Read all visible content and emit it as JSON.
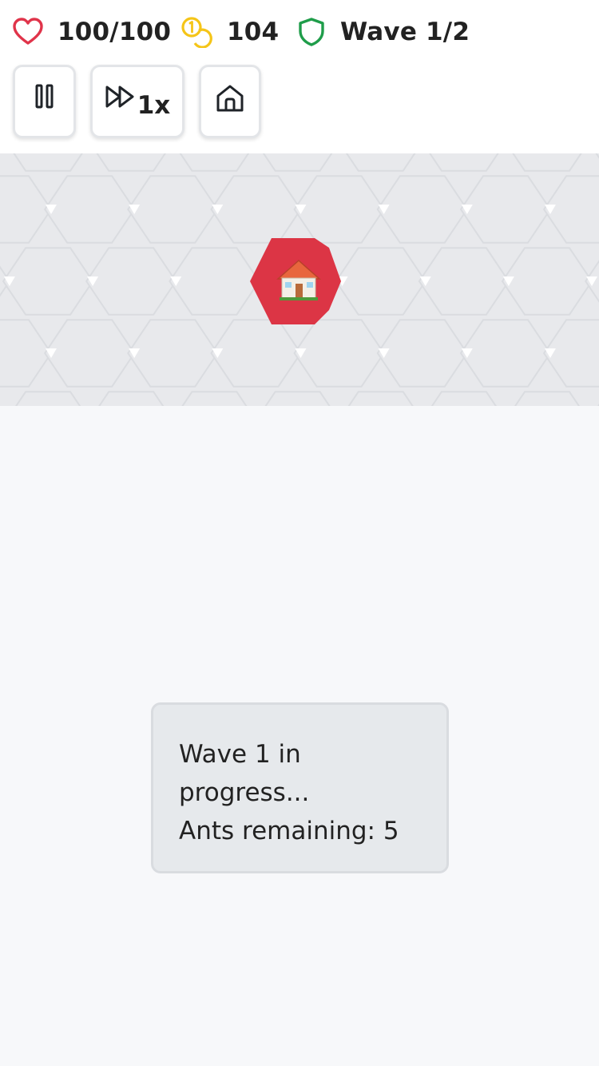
{
  "hud": {
    "health": {
      "icon": "heart-icon",
      "label": "100/100",
      "color": "#e0344a"
    },
    "coins": {
      "icon": "coins-icon",
      "label": "104",
      "color": "#f5c518"
    },
    "wave": {
      "icon": "shield-icon",
      "label": "Wave 1/2",
      "color": "#1f9d4a"
    }
  },
  "controls": {
    "pause": {
      "icon": "pause-icon"
    },
    "speed": {
      "icon": "fast-forward-icon",
      "label": "1x"
    },
    "home": {
      "icon": "home-icon"
    }
  },
  "map": {
    "background": "#e8e9ec",
    "base": {
      "icon": "house-icon",
      "color": "#dc3545"
    }
  },
  "status": {
    "line1": "Wave 1 in progress...",
    "line2": "Ants remaining: 5"
  }
}
